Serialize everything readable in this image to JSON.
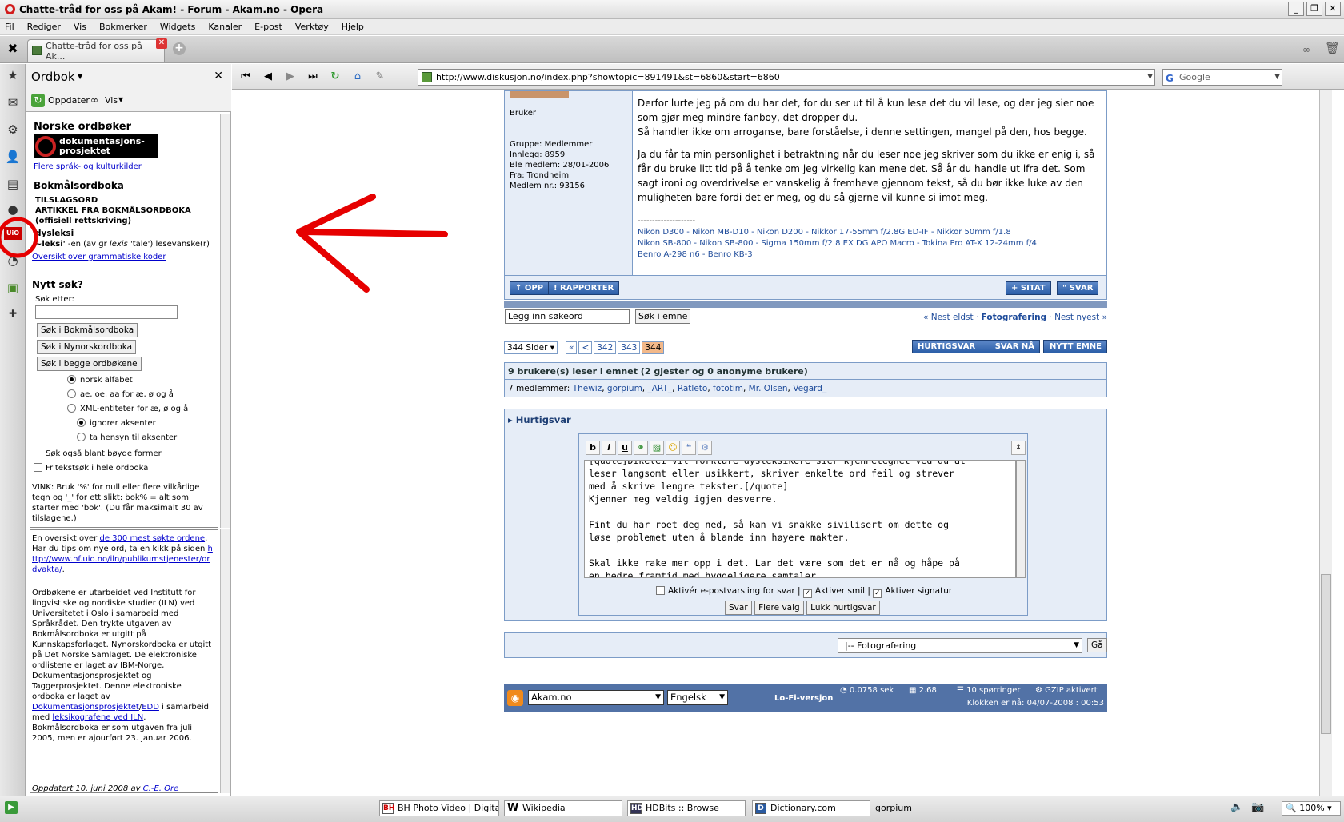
{
  "window": {
    "title": "Chatte-tråd for oss på Akam! - Forum - Akam.no - Opera"
  },
  "menu": [
    "Fil",
    "Rediger",
    "Vis",
    "Bokmerker",
    "Widgets",
    "Kanaler",
    "E-post",
    "Verktøy",
    "Hjelp"
  ],
  "tab": {
    "label": "Chatte-tråd for oss på Ak..."
  },
  "panel": {
    "title": "Ordbok",
    "update": "Oppdater",
    "view": "Vis",
    "norske_heading": "Norske ordbøker",
    "logo_text": "dokumentasjons-\nprosjektet",
    "flere_link": "Flere språk- og kulturkilder",
    "bm_heading": "Bokmålsordboka",
    "tilslag": "TILSLAGSORD",
    "artikkel": "ARTIKKEL FRA BOKMÅLSORDBOKA",
    "offisiell": "(offisiell rettskriving)",
    "word": "dysleksi",
    "definition_head": "~leksi'",
    "definition_rest": " -en (av gr ",
    "definition_lexis": "lexis",
    "definition_tail": " 'tale') lesevanske(r)",
    "grammar_link": "Oversikt over grammatiske koder",
    "nytt_sok": "Nytt søk?",
    "sok_etter": "Søk etter:",
    "btn_bm": "Søk i Bokmålsordboka",
    "btn_nn": "Søk i Nynorskordboka",
    "btn_both": "Søk i begge ordbøkene",
    "radio1": "norsk alfabet",
    "radio2": "ae, oe, aa for æ, ø og å",
    "radio3": "XML-entiteter for æ, ø og å",
    "radio4": "ignorer aksenter",
    "radio5": "ta hensyn til aksenter",
    "check1": "Søk også blant bøyde former",
    "check2": "Fritekstsøk i hele ordboka",
    "vink": "VINK: Bruk '%' for null eller flere vilkårlige tegn og '_' for ett slikt: bok% = alt som starter med 'bok'. (Du får maksimalt 30 av tilslagene.)",
    "oversikt_pre": "En oversikt over ",
    "oversikt_link": "de 300 mest søkte ordene",
    "oversikt_mid": ". Har du tips om nye ord, ta en kikk på siden ",
    "oversikt_url": "http://www.hf.uio.no/iln/publikumstjenester/ordvakta/",
    "oversikt_end": ".",
    "about_1": "Ordbøkene er utarbeidet ved Institutt for lingvistiske og nordiske studier (ILN) ved Universitetet i Oslo i samarbeid med Språkrådet. Den trykte utgaven av Bokmålsordboka er utgitt på Kunnskapsforlaget. Nynorskordboka er utgitt på Det Norske Samlaget. De elektroniske ordlistene er laget av IBM-Norge, Dokumentasjonsprosjektet og Taggerprosjektet. Denne elektroniske ordboka er laget av ",
    "about_link1": "Dokumentasjonsprosjektet",
    "about_slash": "/",
    "about_link2": "EDD",
    "about_2": " i samarbeid med ",
    "about_link3": "leksikografene ved ILN",
    "about_3": ". Bokmålsordboka er som utgaven fra juli 2005, men er ajourført 23. januar 2006.",
    "updated_pre": "Oppdatert 10. juni 2008 av ",
    "updated_link": "C.-E. Ore"
  },
  "address": {
    "url": "http://www.diskusjon.no/index.php?showtopic=891491&st=6860&start=6860",
    "search": "Google"
  },
  "post": {
    "role": "Bruker",
    "gruppe": "Gruppe: Medlemmer",
    "innlegg": "Innlegg: 8959",
    "ble": "Ble medlem: 28/01-2006",
    "fra": "Fra: Trondheim",
    "nr": "Medlem nr.: 93156",
    "p1": "Derfor lurte jeg på om du har det, for du ser ut til å kun lese det du vil lese, og der jeg sier noe som gjør meg mindre fanboy, det dropper du.",
    "p1b": "Så handler ikke om arroganse, bare forståelse, i denne settingen, mangel på den, hos begge.",
    "p2": "Ja du får ta min personlighet i betraktning når du leser noe jeg skriver som du ikke er enig i, så får du bruke litt tid på å tenke om jeg virkelig kan mene det. Så år du handle ut ifra det. Som sagt ironi og overdrivelse er vanskelig å fremheve gjennom tekst, så du bør ikke luke av den muligheten bare fordi det er meg, og du så gjerne vil kunne si imot meg.",
    "sig_sep": "--------------------",
    "sig1": "Nikon D300 - Nikon MB-D10 - Nikon D200 - Nikkor 17-55mm f/2.8G ED-IF - Nikkor 50mm f/1.8",
    "sig2": "Nikon SB-800 - Nikon SB-800 - Sigma 150mm f/2.8 EX DG APO Macro - Tokina Pro AT-X 12-24mm f/4",
    "sig3": "Benro A-298 n6 - Benro KB-3",
    "btn_opp": "OPP",
    "btn_rapporter": "RAPPORTER",
    "btn_sitat": "SITAT",
    "btn_svar": "SVAR"
  },
  "topicsearch": {
    "placeholder": "Legg inn søkeord",
    "button": "Søk i emne",
    "prev": "« Nest eldst",
    "sep1": " · ",
    "forum": "Fotografering",
    "sep2": " · ",
    "next": "Nest nyest »"
  },
  "pagination": {
    "select": "344 Sider",
    "first": "«",
    "prev": "<",
    "p1": "342",
    "p2": "343",
    "current": "344",
    "btn_hurtig": "HURTIGSVAR",
    "btn_svarna": "SVAR NÅ",
    "btn_nytt": "NYTT EMNE"
  },
  "readers": {
    "heading": "9 brukere(s) leser i emnet (2 gjester og 0 anonyme brukere)",
    "label": "7 medlemmer:",
    "names": [
      "Thewiz",
      "gorpium",
      "_ART_",
      "Ratleto",
      "fototim",
      "Mr. Olsen",
      "Vegard_"
    ]
  },
  "quickreply": {
    "heading": "Hurtigsvar",
    "text": "[quote]Dikelei vil forklare dysleksikere sier kjennetegnet ved du at\nleser langsomt eller usikkert, skriver enkelte ord feil og strever\nmed å skrive lengre tekster.[/quote]\nKjenner meg veldig igjen desverre.\n\nFint du har roet deg ned, så kan vi snakke sivilisert om dette og\nløse problemet uten å blande inn høyere makter.\n\nSkal ikke rake mer opp i det. Lar det være som det er nå og håpe på\nen bedre framtid med hyggeligere samtaler.",
    "opt1": "Aktivér e-postvarsling for svar",
    "opt2": "Aktiver smil",
    "opt3": "Aktiver signatur",
    "sep": " | ",
    "btn_svar": "Svar",
    "btn_flere": "Flere valg",
    "btn_lukk": "Lukk hurtigsvar"
  },
  "jump": {
    "select": "|-- Fotografering",
    "go": "Gå"
  },
  "footer": {
    "site": "Akam.no",
    "lang": "Engelsk",
    "lofi": "Lo-Fi-versjon",
    "time": "0.0758 sek",
    "load": "2.68",
    "queries": "10 spørringer",
    "gzip": "GZIP aktivert",
    "clock": "Klokken er nå: 04/07-2008 : 00:53"
  },
  "status": {
    "items": [
      "BH Photo Video | Digital C",
      "Wikipedia",
      "HDBits :: Browse",
      "Dictionary.com"
    ],
    "user": "gorpium",
    "zoom": "100%"
  },
  "colors": {
    "annotation": "#e60000",
    "forum_border": "#7c9cc7",
    "forum_bg": "#e6edf7",
    "current_page": "#f2b889"
  }
}
